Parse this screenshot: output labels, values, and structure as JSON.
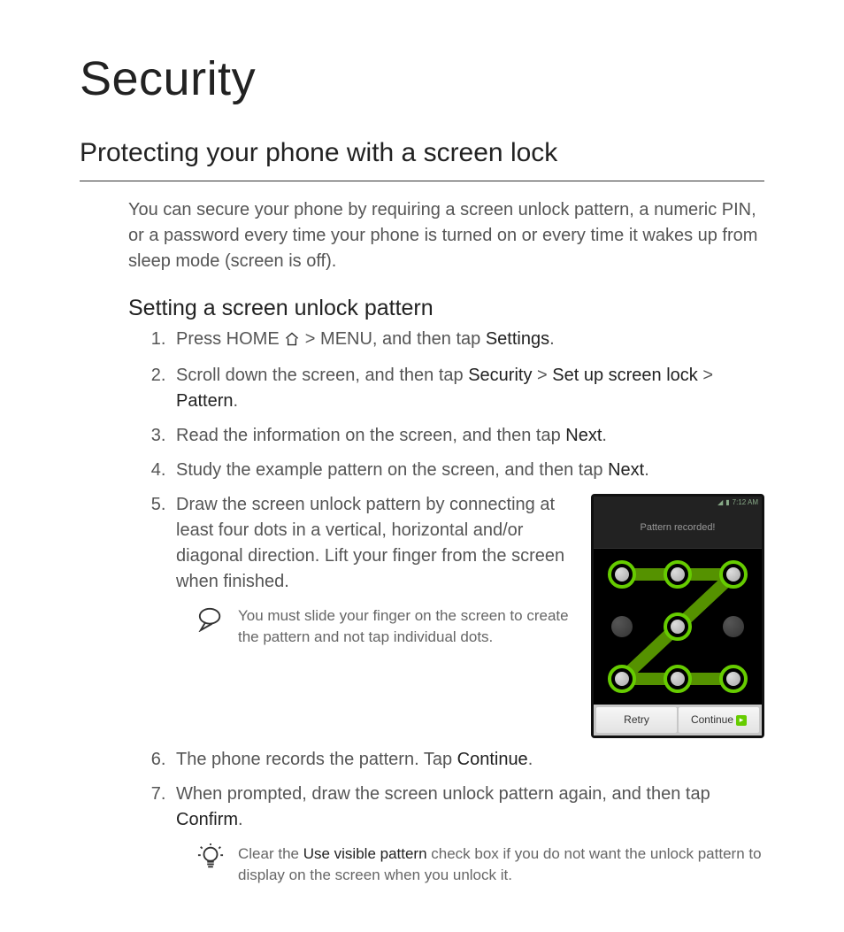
{
  "title": "Security",
  "section_title": "Protecting your phone with a screen lock",
  "intro": "You can secure your phone by requiring a screen unlock pattern, a numeric PIN, or a password every time your phone is turned on or every time it wakes up from sleep mode (screen is off).",
  "sub_title": "Setting a screen unlock pattern",
  "steps": {
    "s1_a": "Press HOME ",
    "s1_b": " > MENU, and then tap ",
    "s1_c": "Settings",
    "s1_d": ".",
    "s2_a": "Scroll down the screen, and then tap ",
    "s2_b": "Security",
    "s2_c": " > ",
    "s2_d": "Set up screen lock",
    "s2_e": " > ",
    "s2_f": "Pattern",
    "s2_g": ".",
    "s3_a": "Read the information on the screen, and then tap ",
    "s3_b": "Next",
    "s3_c": ".",
    "s4_a": "Study the example pattern on the screen, and then tap ",
    "s4_b": "Next",
    "s4_c": ".",
    "s5": "Draw the screen unlock pattern by connecting at least four dots in a vertical, horizontal and/or diagonal direction. Lift your finger from the screen when finished.",
    "note1": "You must slide your finger on the screen to create the pattern and not tap individual dots.",
    "s6_a": "The phone records the pattern. Tap ",
    "s6_b": "Continue",
    "s6_c": ".",
    "s7_a": "When prompted, draw the screen unlock pattern again, and then tap ",
    "s7_b": "Confirm",
    "s7_c": ".",
    "note2_a": "Clear the ",
    "note2_b": "Use visible pattern",
    "note2_c": " check box if you do not want the unlock pattern to display on the screen when you unlock it."
  },
  "phone": {
    "status_time": "7:12 AM",
    "header": "Pattern recorded!",
    "btn_retry": "Retry",
    "btn_continue": "Continue"
  }
}
